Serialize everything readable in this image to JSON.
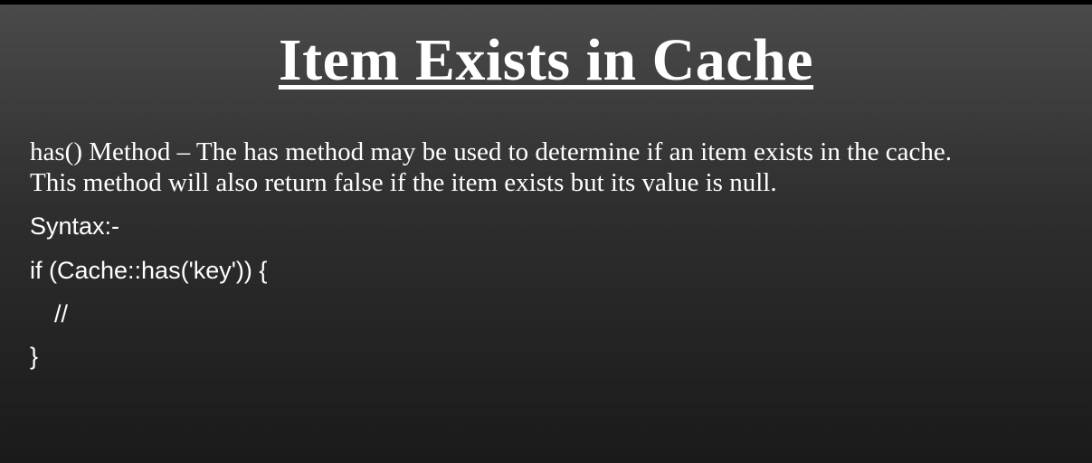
{
  "slide": {
    "title": "Item Exists in Cache",
    "description_line1": "has() Method –  The has method may be used to determine if an item exists in the cache.",
    "description_line2": "This method will also return false if the item exists but its value is null.",
    "syntax_label": "Syntax:-",
    "code": [
      "if (Cache::has('key')) {",
      "//",
      "}"
    ]
  }
}
